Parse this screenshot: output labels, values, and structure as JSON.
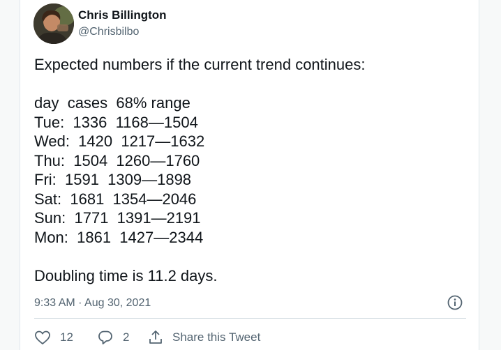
{
  "author": {
    "display_name": "Chris Billington",
    "handle": "@Chrisbilbo"
  },
  "tweet": {
    "intro": "Expected numbers if the current trend continues:",
    "table_header": "day  cases  68% range",
    "rows": [
      "Tue:  1336  1168—1504",
      "Wed:  1420  1217—1632",
      "Thu:  1504  1260—1760",
      "Fri:  1591  1309—1898",
      "Sat:  1681  1354—2046",
      "Sun:  1771  1391—2191",
      "Mon:  1861  1427—2344"
    ],
    "conclusion": "Doubling time is 11.2 days."
  },
  "meta": {
    "timestamp": "9:33 AM · Aug 30, 2021"
  },
  "actions": {
    "like_count": "12",
    "reply_count": "2",
    "share_label": "Share this Tweet"
  },
  "icons": {
    "info": "info-icon",
    "like": "heart-icon",
    "reply": "reply-bubble-icon",
    "share": "share-upload-icon"
  },
  "colors": {
    "text": "#0f1419",
    "secondary": "#536471",
    "divider": "#cfd9de"
  }
}
